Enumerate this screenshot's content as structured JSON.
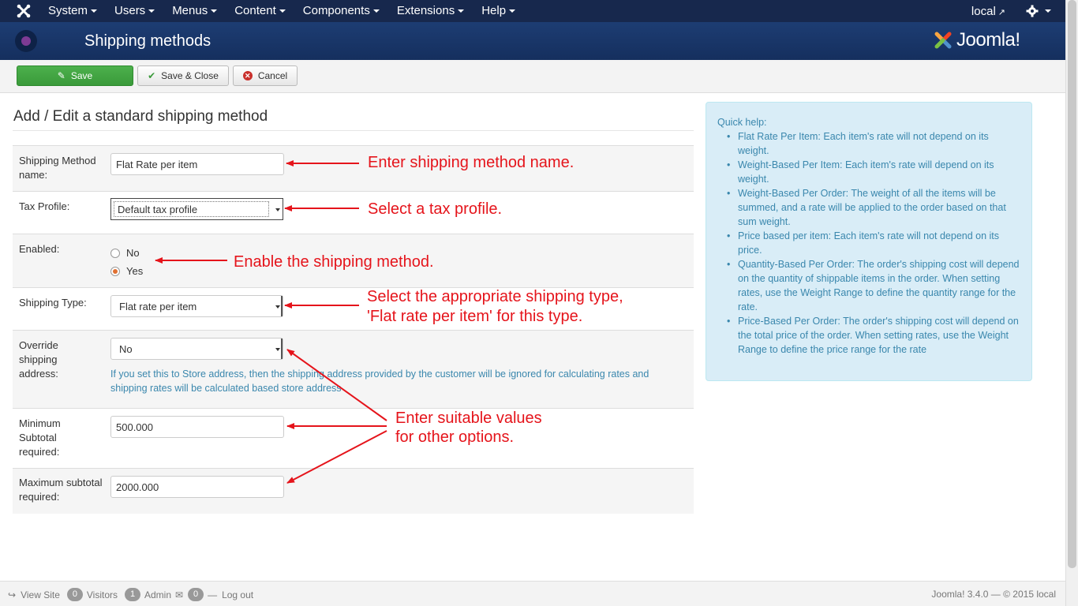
{
  "navbar": {
    "menu": [
      "System",
      "Users",
      "Menus",
      "Content",
      "Components",
      "Extensions",
      "Help"
    ],
    "site_link": "local"
  },
  "header": {
    "title": "Shipping methods",
    "brand": "Joomla!"
  },
  "toolbar": {
    "save": "Save",
    "save_close": "Save & Close",
    "cancel": "Cancel"
  },
  "form": {
    "heading": "Add / Edit a standard shipping method",
    "name_label": "Shipping Method name:",
    "name_value": "Flat Rate per item",
    "tax_label": "Tax Profile:",
    "tax_value": "Default tax profile",
    "enabled_label": "Enabled:",
    "enabled_options": [
      "No",
      "Yes"
    ],
    "enabled_selected": "Yes",
    "type_label": "Shipping Type:",
    "type_value": "Flat rate per item",
    "override_label": "Override shipping address:",
    "override_value": "No",
    "override_help": "If you set this to Store address, then the shipping address provided by the customer will be ignored for calculating rates and shipping rates will be calculated based store address",
    "min_label": "Minimum Subtotal required:",
    "min_value": "500.000",
    "max_label": "Maximum subtotal required:",
    "max_value": "2000.000"
  },
  "quick_help": {
    "title": "Quick help:",
    "items": [
      "Flat Rate Per Item: Each item's rate will not depend on its weight.",
      "Weight-Based Per Item: Each item's rate will depend on its weight.",
      "Weight-Based Per Order: The weight of all the items will be summed, and a rate will be applied to the order based on that sum weight.",
      "Price based per item: Each item's rate will not depend on its price.",
      "Quantity-Based Per Order: The order's shipping cost will depend on the quantity of shippable items in the order. When setting rates, use the Weight Range to define the quantity range for the rate.",
      "Price-Based Per Order: The order's shipping cost will depend on the total price of the order. When setting rates, use the Weight Range to define the price range for the rate"
    ]
  },
  "annotations": {
    "name": "Enter shipping method name.",
    "tax": "Select a tax profile.",
    "enable": "Enable the shipping method.",
    "type_line1": "Select the appropriate shipping type,",
    "type_line2": "'Flat rate per item' for this type.",
    "other_line1": "Enter suitable values",
    "other_line2": "for other options."
  },
  "footer": {
    "view_site": "View Site",
    "visitors_count": "0",
    "visitors": "Visitors",
    "admin_count": "1",
    "admin": "Admin",
    "messages_count": "0",
    "logout": "Log out",
    "version": "Joomla! 3.4.0 — © 2015 local"
  },
  "colors": {
    "navbar": "#17284d",
    "header": "#1d3d73",
    "save_button": "#46a546",
    "annotation": "#e5141b",
    "help_text": "#3a87ad"
  },
  "icons": [
    "joomla-x-icon",
    "external-link-icon",
    "gear-icon",
    "shop-icon",
    "edit-icon",
    "check-icon",
    "cancel-icon",
    "view-site-icon",
    "mail-icon",
    "logout-icon"
  ]
}
